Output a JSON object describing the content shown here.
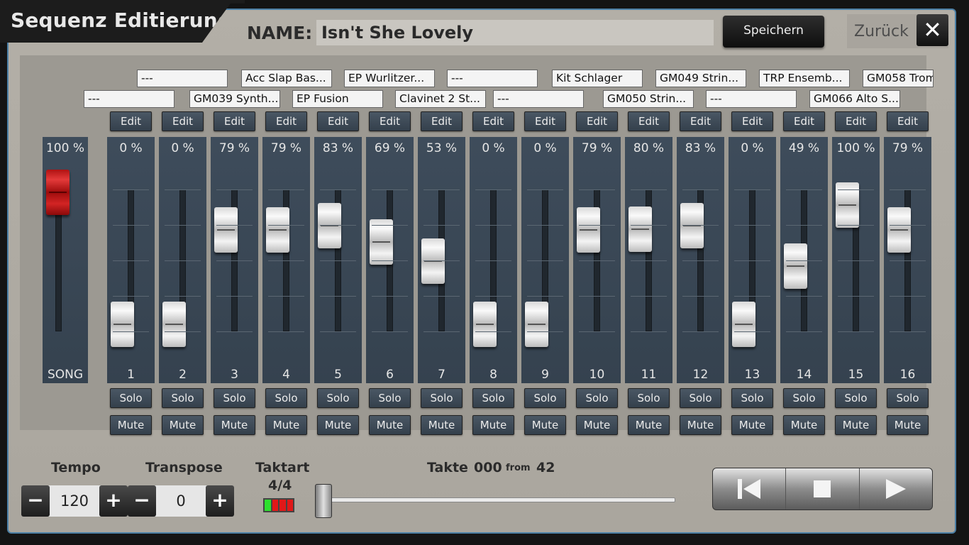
{
  "window": {
    "title": "Sequenz Editierung",
    "name_label": "NAME:",
    "name_value": "Isn't She Lovely",
    "save_label": "Speichern",
    "back_label": "Zurück",
    "close_icon": "close-icon"
  },
  "sounds": [
    "---",
    "Acc Slap Bas...",
    "EP Wurlitzer...",
    "---",
    "Kit Schlager",
    "GM049 Strin...",
    "TRP Ensemb...",
    "GM058 Trom",
    "---",
    "GM039 Synth...",
    "EP Fusion",
    "Clavinet 2 St...",
    "---",
    "GM050 Strin...",
    "---",
    "GM066 Alto S..."
  ],
  "song": {
    "pct": "100 %",
    "label": "SONG",
    "level": 100
  },
  "channels": [
    {
      "num": "1",
      "pct": "0 %",
      "level": 0
    },
    {
      "num": "2",
      "pct": "0 %",
      "level": 0
    },
    {
      "num": "3",
      "pct": "79 %",
      "level": 79
    },
    {
      "num": "4",
      "pct": "79 %",
      "level": 79
    },
    {
      "num": "5",
      "pct": "83 %",
      "level": 83
    },
    {
      "num": "6",
      "pct": "69 %",
      "level": 69
    },
    {
      "num": "7",
      "pct": "53 %",
      "level": 53
    },
    {
      "num": "8",
      "pct": "0 %",
      "level": 0
    },
    {
      "num": "9",
      "pct": "0 %",
      "level": 0
    },
    {
      "num": "10",
      "pct": "79 %",
      "level": 79
    },
    {
      "num": "11",
      "pct": "80 %",
      "level": 80
    },
    {
      "num": "12",
      "pct": "83 %",
      "level": 83
    },
    {
      "num": "13",
      "pct": "0 %",
      "level": 0
    },
    {
      "num": "14",
      "pct": "49 %",
      "level": 49
    },
    {
      "num": "15",
      "pct": "100 %",
      "level": 100
    },
    {
      "num": "16",
      "pct": "79 %",
      "level": 79
    }
  ],
  "buttons": {
    "edit": "Edit",
    "solo": "Solo",
    "mute": "Mute"
  },
  "tempo": {
    "label": "Tempo",
    "value": "120",
    "minus": "−",
    "plus": "+"
  },
  "transpose": {
    "label": "Transpose",
    "value": "0",
    "minus": "−",
    "plus": "+"
  },
  "meter": {
    "label": "Taktart",
    "value": "4/4",
    "led_colors": [
      "#2de02d",
      "#e01818",
      "#e01818",
      "#e01818"
    ]
  },
  "takte": {
    "label": "Takte",
    "current": "000",
    "from_label": "from",
    "total": "42",
    "progress": 0
  },
  "transport": {
    "prev_icon": "skip-back-icon",
    "stop_icon": "stop-icon",
    "play_icon": "play-icon"
  },
  "colors": {
    "accent_border": "#4b7fa6",
    "strip": "#3a4756",
    "song_knob": "#c41a1a"
  }
}
